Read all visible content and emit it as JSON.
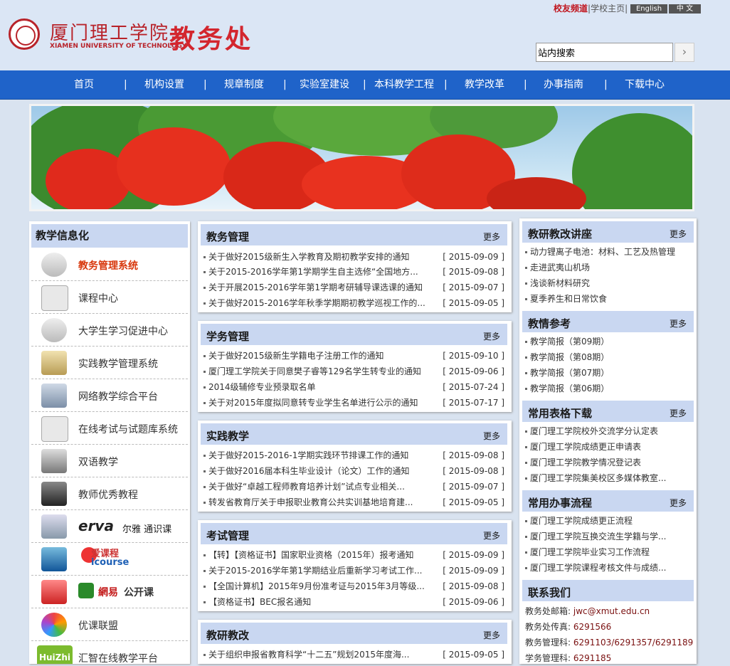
{
  "header": {
    "logo_cn": "厦门理工学院",
    "logo_en": "XIAMEN UNIVERSITY OF TECHNOLOGY",
    "dept": "教务处",
    "toplinks": [
      "校友频道",
      "学校主页"
    ],
    "lang": [
      "English",
      "中 文"
    ],
    "search_placeholder": "站内搜索",
    "search_btn": "›"
  },
  "nav": [
    "首页",
    "机构设置",
    "规章制度",
    "实验室建设",
    "本科教学工程",
    "教学改革",
    "办事指南",
    "下载中心"
  ],
  "nav_sep": "|",
  "left": {
    "title": "教学信息化",
    "items": [
      "教务管理系统",
      "课程中心",
      "大学生学习促进中心",
      "实践教学管理系统",
      "网络教学综合平台",
      "在线考试与试题库系统",
      "双语教学",
      "教师优秀教程",
      "",
      "",
      "",
      "优课联盟",
      "汇智在线教学平台"
    ],
    "logos": [
      "erva",
      "尔雅 通识课",
      "爱课程",
      "icourse",
      "網易",
      "公开课",
      "HuiZhi"
    ]
  },
  "mid": [
    {
      "title": "教务管理",
      "more": "更多",
      "rows": [
        {
          "t": "关于做好2015级新生入学教育及期初教学安排的通知",
          "d": "[ 2015-09-09 ]"
        },
        {
          "t": "关于2015-2016学年第1学期学生自主选修“全国地方...",
          "d": "[ 2015-09-08 ]"
        },
        {
          "t": "关于开展2015-2016学年第1学期考研辅导课选课的通知",
          "d": "[ 2015-09-07 ]"
        },
        {
          "t": "关于做好2015-2016学年秋季学期期初教学巡视工作的...",
          "d": "[ 2015-09-05 ]"
        }
      ]
    },
    {
      "title": "学务管理",
      "more": "更多",
      "rows": [
        {
          "t": "关于做好2015级新生学籍电子注册工作的通知",
          "d": "[ 2015-09-10 ]"
        },
        {
          "t": "厦门理工学院关于同意樊子睿等129名学生转专业的通知",
          "d": "[ 2015-09-06 ]"
        },
        {
          "t": "2014级辅修专业预录取名单",
          "d": "[ 2015-07-24 ]"
        },
        {
          "t": "关于对2015年度拟同意转专业学生名单进行公示的通知",
          "d": "[ 2015-07-17 ]"
        }
      ]
    },
    {
      "title": "实践教学",
      "more": "更多",
      "rows": [
        {
          "t": "关于做好2015-2016-1学期实践环节排课工作的通知",
          "d": "[ 2015-09-08 ]"
        },
        {
          "t": "关于做好2016届本科生毕业设计（论文）工作的通知",
          "d": "[ 2015-09-08 ]"
        },
        {
          "t": "关于做好“卓越工程师教育培养计划”试点专业相关...",
          "d": "[ 2015-09-07 ]"
        },
        {
          "t": "转发省教育厅关于申报职业教育公共实训基地培育建...",
          "d": "[ 2015-09-05 ]"
        }
      ]
    },
    {
      "title": "考试管理",
      "more": "更多",
      "rows": [
        {
          "t": "【转】【资格证书】国家职业资格（2015年）报考通知",
          "d": "[ 2015-09-09 ]"
        },
        {
          "t": "关于2015-2016学年第1学期结业后重新学习考试工作...",
          "d": "[ 2015-09-09 ]"
        },
        {
          "t": "【全国计算机】2015年9月份准考证与2015年3月等级...",
          "d": "[ 2015-09-08 ]"
        },
        {
          "t": "【资格证书】BEC报名通知",
          "d": "[ 2015-09-06 ]"
        }
      ]
    },
    {
      "title": "教研教改",
      "more": "更多",
      "rows": [
        {
          "t": "关于组织申报省教育科学“十二五”规划2015年度海...",
          "d": "[ 2015-09-05 ]"
        }
      ]
    }
  ],
  "right": [
    {
      "title": "教研教改讲座",
      "more": "更多",
      "rows": [
        "动力锂离子电池：材料、工艺及热管理",
        "走进武夷山机场",
        "浅谈新材料研究",
        "夏季养生和日常饮食"
      ]
    },
    {
      "title": "教情参考",
      "more": "更多",
      "rows": [
        "教学简报（第09期）",
        "教学简报（第08期）",
        "教学简报（第07期）",
        "教学简报（第06期）"
      ]
    },
    {
      "title": "常用表格下载",
      "more": "更多",
      "rows": [
        "厦门理工学院校外交流学分认定表",
        "厦门理工学院成绩更正申请表",
        "厦门理工学院教学情况登记表",
        "厦门理工学院集美校区多媒体教室..."
      ]
    },
    {
      "title": "常用办事流程",
      "more": "更多",
      "rows": [
        "厦门理工学院成绩更正流程",
        "厦门理工学院互换交流生学籍与学...",
        "厦门理工学院毕业实习工作流程",
        "厦门理工学院课程考核文件与成绩..."
      ]
    }
  ],
  "contact": {
    "title": "联系我们",
    "rows": [
      {
        "k": "教务处邮箱:",
        "v": "jwc@xmut.edu.cn"
      },
      {
        "k": "教务处传真:",
        "v": "6291566"
      },
      {
        "k": "教务管理科:",
        "v": "6291103/6291357/6291189"
      },
      {
        "k": "学务管理科:",
        "v": "6291185"
      }
    ]
  }
}
